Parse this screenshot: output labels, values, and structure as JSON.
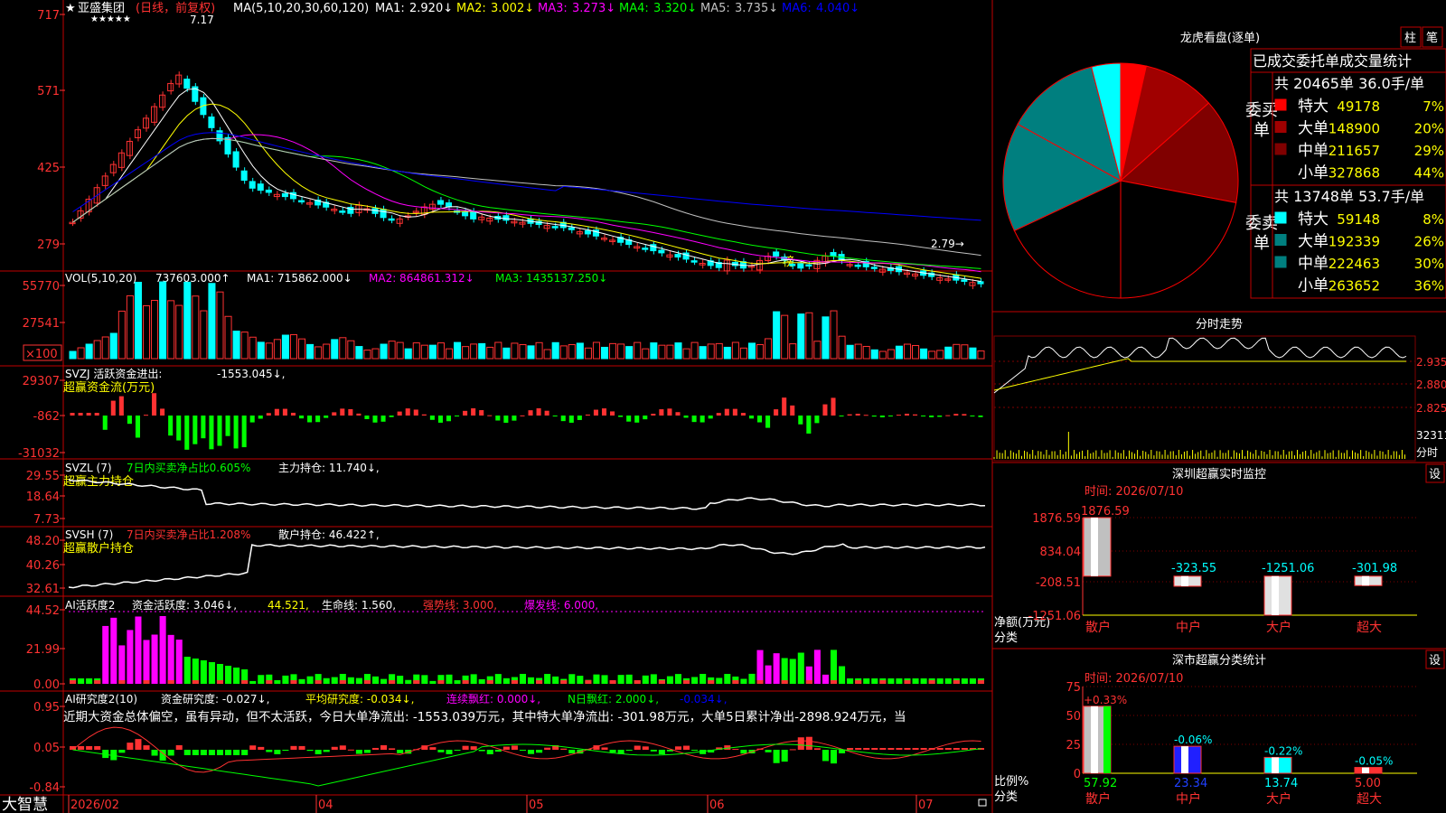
{
  "colors": {
    "up": "#ff3232",
    "down": "#00ffff",
    "ma1": "#ffffff",
    "ma2": "#ffff00",
    "ma3": "#ff00ff",
    "ma4": "#00ff00",
    "ma5": "#c0c0c0",
    "ma6": "#0000ff",
    "axis": "#ff0000",
    "grid": "#800000"
  },
  "stock": {
    "star": "★",
    "name": "亚盛集团",
    "period": "(日线，前复权)",
    "ma_label": "MA(5,10,20,30,60,120)",
    "ma_values": [
      {
        "label": "MA1:",
        "value": "2.920↓"
      },
      {
        "label": "MA2:",
        "value": "3.002↓"
      },
      {
        "label": "MA3:",
        "value": "3.273↓"
      },
      {
        "label": "MA4:",
        "value": "3.320↓"
      },
      {
        "label": "MA5:",
        "value": "3.735↓"
      },
      {
        "label": "MA6:",
        "value": "4.040↓"
      }
    ],
    "high_mark": "7.17",
    "low_mark": "2.79→",
    "bang": "榜",
    "stars": "★★★★★"
  },
  "price_axis": [
    "717",
    "571",
    "425",
    "279"
  ],
  "vol": {
    "label": "VOL(5,10,20)",
    "value": "737603.000↑",
    "ma1": "MA1: 715862.000↓",
    "ma2": "MA2: 864861.312↓",
    "ma3": "MA3: 1435137.250↓",
    "axis": [
      "55770",
      "27541"
    ],
    "unit": "×100"
  },
  "svzj": {
    "label": "SVZJ  活跃资金进出:",
    "value": "-1553.045↓,",
    "subtitle": "超赢资金流(万元)",
    "axis": [
      "29307",
      "-862",
      "-31032"
    ]
  },
  "svzl": {
    "label": "SVZL (7)",
    "desc": "7日内买卖净占比0.605%",
    "value": "主力持仓: 11.740↓,",
    "subtitle": "超赢主力持仓",
    "axis": [
      "29.55",
      "18.64",
      "7.73"
    ]
  },
  "svsh": {
    "label": "SVSH (7)",
    "desc": "7日内买卖净占比1.208%",
    "value": "散户持仓: 46.422↑,",
    "subtitle": "超赢散户持仓",
    "axis": [
      "48.20",
      "40.26",
      "32.61"
    ]
  },
  "ai_act": {
    "label": "AI活跃度2",
    "v1": "资金活跃度: 3.046↓,",
    "v2": "44.521,",
    "v3": "生命线: 1.560,",
    "v4": "强势线: 3.000,",
    "v5": "爆发线: 6.000,",
    "axis": [
      "44.52",
      "21.99",
      "0.00"
    ]
  },
  "ai_res": {
    "label": "AI研究度2(10)",
    "v1": "资金研究度: -0.027↓,",
    "v2": "平均研究度: -0.034↓,",
    "v3": "连续飘红: 0.000↓,",
    "v4": "N日飘红: 2.000↓,",
    "v5": "-0.034↓,",
    "comment": "近期大资金总体偏空，虽有异动，但不太活跃，今日大单净流出: -1553.039万元，其中特大单净流出: -301.98万元，大单5日累计净出-2898.924万元，当",
    "axis": [
      "0.95",
      "0.05",
      "-0.84"
    ]
  },
  "bottom": {
    "brand": "大智慧",
    "dates": [
      "2026/02",
      "04",
      "05",
      "06",
      "07"
    ]
  },
  "lhb": {
    "title": "龙虎看盘(逐单)",
    "btn1": "柱",
    "btn2": "笔",
    "header": "已成交委托单成交量统计",
    "buy": {
      "side": "委买单",
      "summary": "共 20465单 36.0手/单",
      "rows": [
        [
          "特大",
          "49178",
          "7%"
        ],
        [
          "大单",
          "148900",
          "20%"
        ],
        [
          "中单",
          "211657",
          "29%"
        ],
        [
          "小单",
          "327868",
          "44%"
        ]
      ]
    },
    "sell": {
      "side": "委卖单",
      "summary": "共 13748单 53.7手/单",
      "rows": [
        [
          "特大",
          "59148",
          "8%"
        ],
        [
          "大单",
          "192339",
          "26%"
        ],
        [
          "中单",
          "222463",
          "30%"
        ],
        [
          "小单",
          "263652",
          "36%"
        ]
      ]
    }
  },
  "fenshi": {
    "title": "分时走势",
    "axis": [
      "2.935",
      "2.880",
      "2.825"
    ],
    "vol_axis": "32311",
    "vol_unit": "分时"
  },
  "sz_monitor": {
    "title": "深圳超赢实时监控",
    "btn": "设",
    "time": "时间: 2026/07/10",
    "axis": [
      "1876.59",
      "834.04",
      "-208.51",
      "-1251.06"
    ],
    "ylabel1": "净额(万元)",
    "ylabel2": "分类",
    "bars": [
      {
        "cat": "散户",
        "value": 1876.59,
        "label": "1876.59"
      },
      {
        "cat": "中户",
        "value": -323.55,
        "label": "-323.55"
      },
      {
        "cat": "大户",
        "value": -1251.06,
        "label": "-1251.06"
      },
      {
        "cat": "超大",
        "value": -301.98,
        "label": "-301.98"
      }
    ]
  },
  "sz_stats": {
    "title": "深市超赢分类统计",
    "btn": "设",
    "time": "时间: 2026/07/10",
    "axis": [
      "75",
      "50",
      "25",
      "0"
    ],
    "ylabel1": "比例%",
    "ylabel2": "分类",
    "bars": [
      {
        "cat": "散户",
        "value": 57.92,
        "label": "57.92",
        "delta": "+0.33%"
      },
      {
        "cat": "中户",
        "value": 23.34,
        "label": "23.34",
        "delta": "-0.06%"
      },
      {
        "cat": "大户",
        "value": 13.74,
        "label": "13.74",
        "delta": "-0.22%"
      },
      {
        "cat": "超大",
        "value": 5.0,
        "label": "5.00",
        "delta": "-0.05%"
      }
    ]
  }
}
